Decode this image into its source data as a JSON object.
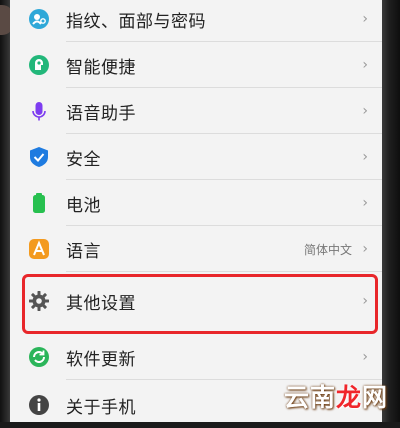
{
  "settings": {
    "items": [
      {
        "label": "指纹、面部与密码",
        "icon": "fingerprint-face-icon",
        "color": "#2ea8d8"
      },
      {
        "label": "智能便捷",
        "icon": "smart-assist-icon",
        "color": "#22b77a"
      },
      {
        "label": "语音助手",
        "icon": "microphone-icon",
        "color": "#7d3cf0"
      },
      {
        "label": "安全",
        "icon": "shield-check-icon",
        "color": "#1e7be0"
      },
      {
        "label": "电池",
        "icon": "battery-icon",
        "color": "#27c04f"
      },
      {
        "label": "语言",
        "icon": "language-icon",
        "color": "#f39a1f",
        "value": "简体中文"
      },
      {
        "label": "其他设置",
        "icon": "gear-icon",
        "color": "#555555"
      },
      {
        "label": "软件更新",
        "icon": "software-update-icon",
        "color": "#2bb55a"
      },
      {
        "label": "关于手机",
        "icon": "info-icon",
        "color": "#444444"
      }
    ],
    "chevron": "›"
  },
  "highlight_color": "#e8262a",
  "watermark": {
    "part1": "云南",
    "part2": "龙",
    "part3": "网"
  }
}
